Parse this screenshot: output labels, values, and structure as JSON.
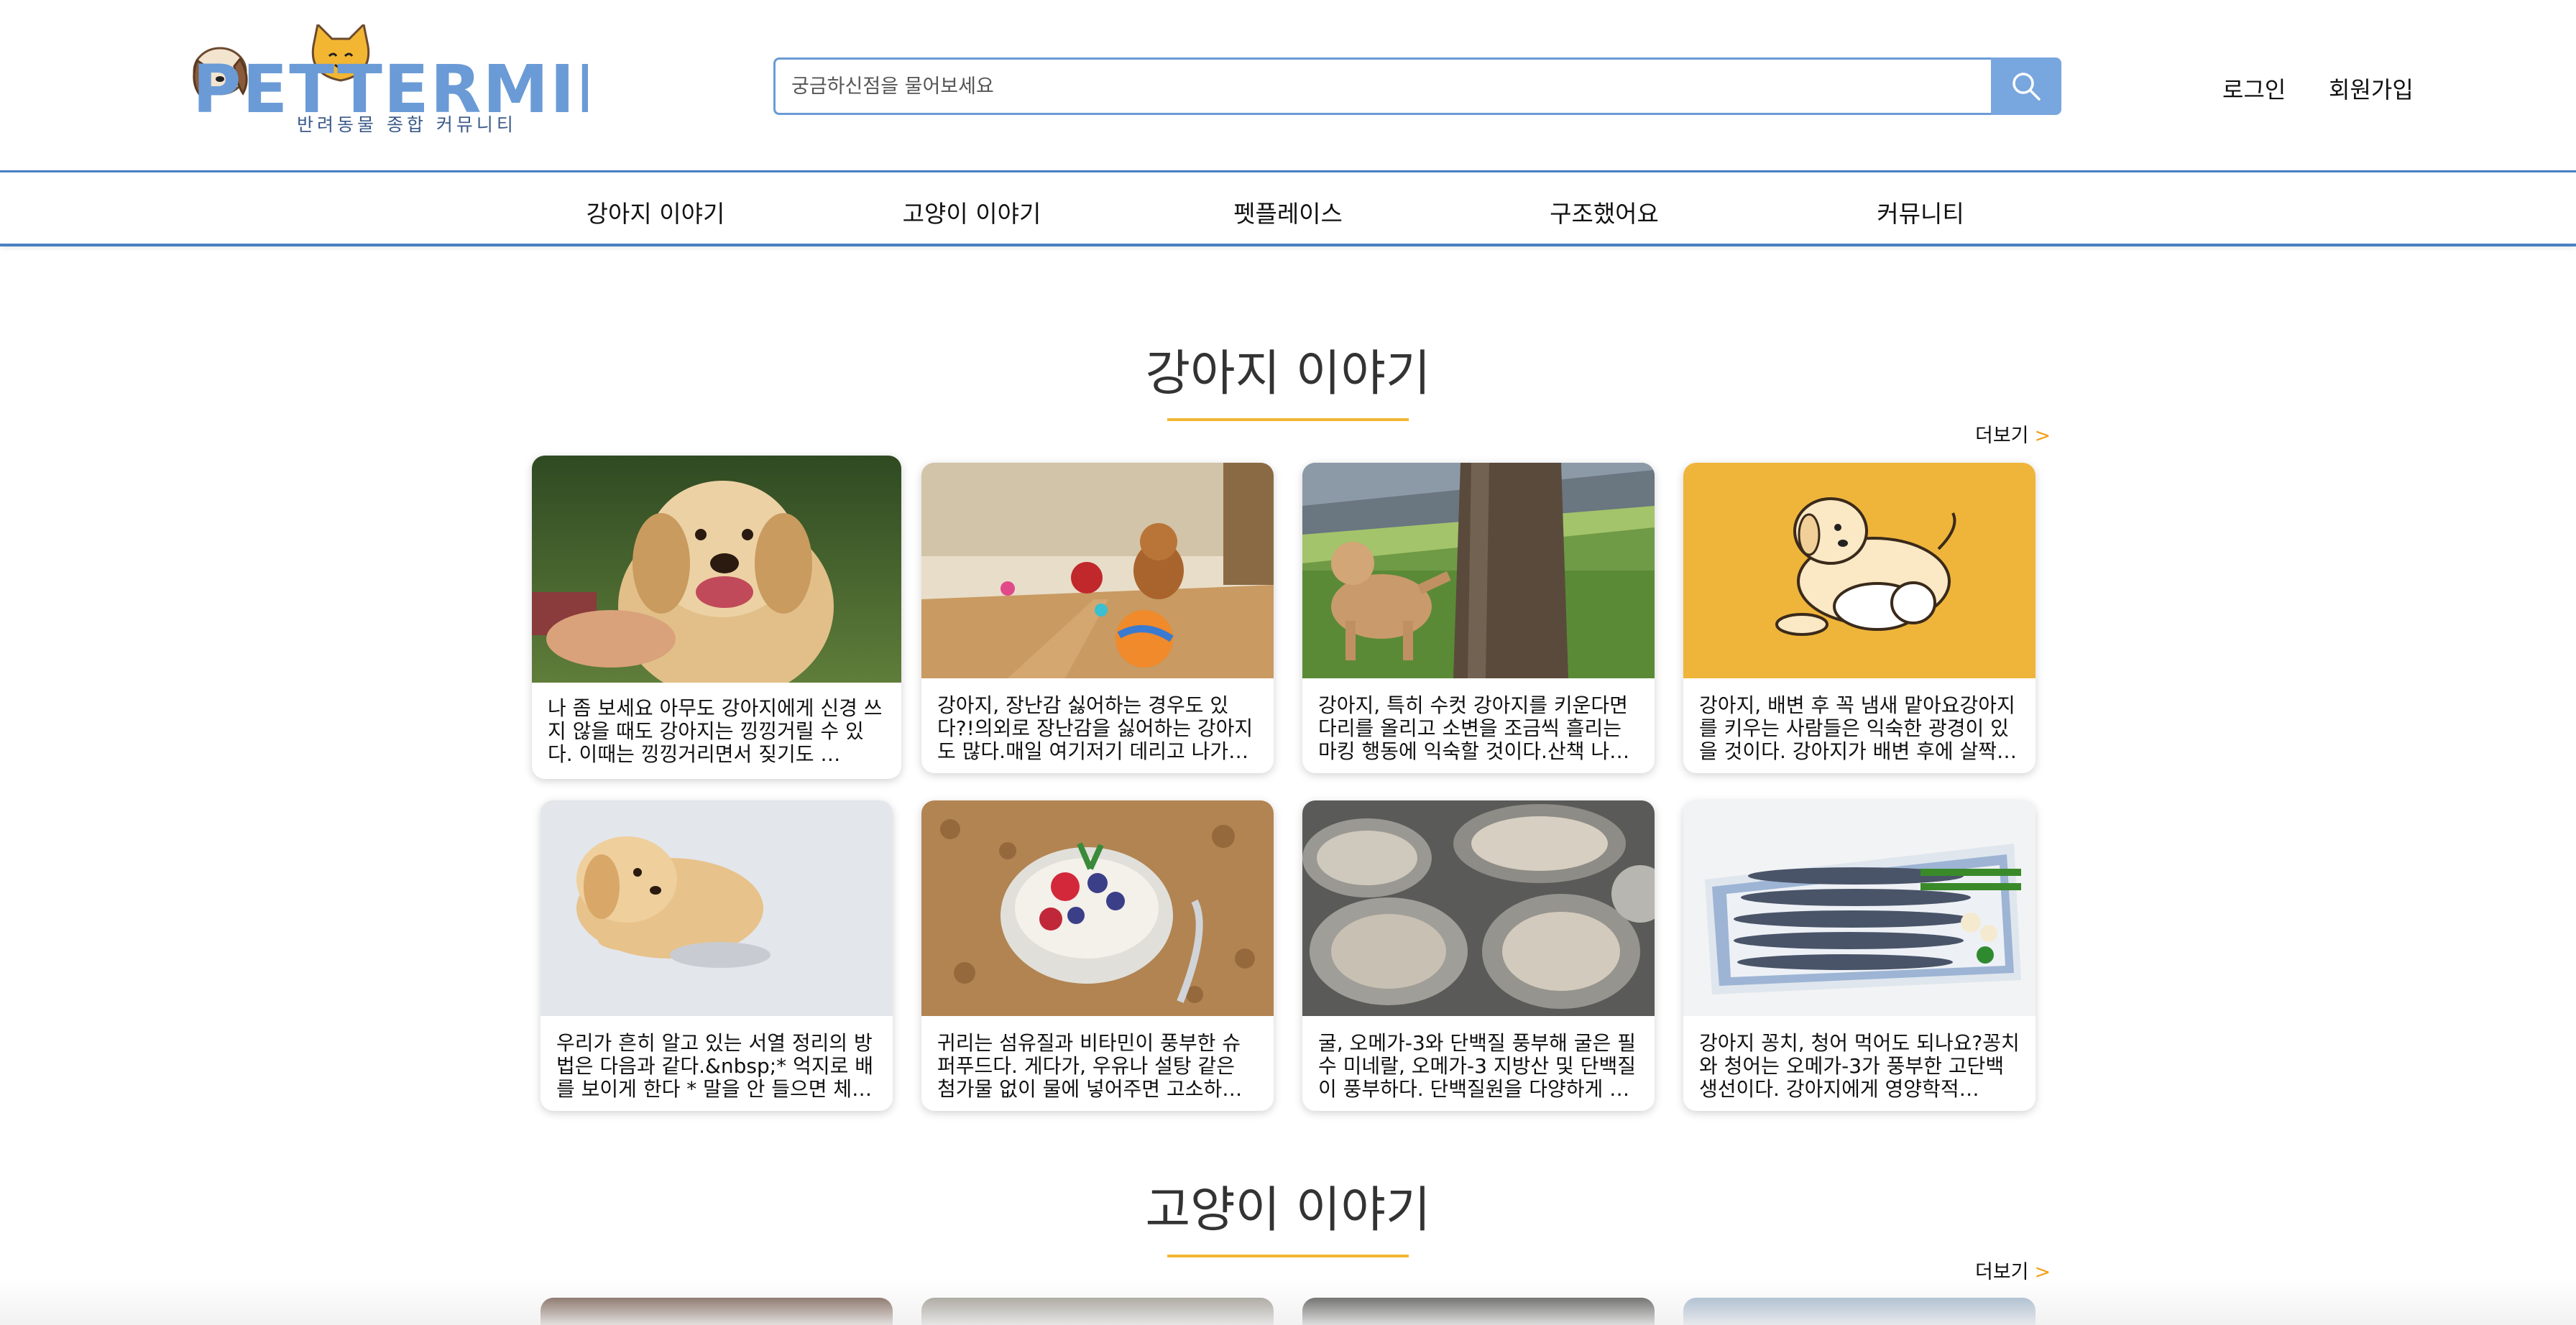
{
  "header": {
    "logo_text": "PETTERMINT",
    "logo_subtitle": "반려동물 종합 커뮤니티",
    "search_placeholder": "궁금하신점을 물어보세요",
    "login_label": "로그인",
    "signup_label": "회원가입",
    "search_icon": "search-icon"
  },
  "nav": {
    "items": [
      {
        "label": "강아지 이야기"
      },
      {
        "label": "고양이 이야기"
      },
      {
        "label": "펫플레이스"
      },
      {
        "label": "구조했어요"
      },
      {
        "label": "커뮤니티"
      }
    ]
  },
  "dog_section": {
    "title": "강아지 이야기",
    "more_label": "더보기",
    "more_arrow": ">",
    "cards": [
      {
        "text": "나 좀 보세요 아무도 강아지에게 신경 쓰지 않을 때도 강아지는 낑낑거릴 수 있다. 이때는 낑낑거리면서 짖기도 …"
      },
      {
        "text": "강아지, 장난감 싫어하는 경우도 있다?!의외로 장난감을 싫어하는 강아지도 많다.매일 여기저기 데리고 나가…"
      },
      {
        "text": "강아지, 특히 수컷 강아지를 키운다면 다리를 올리고 소변을 조금씩 흘리는 마킹 행동에 익숙할 것이다.산책 나…"
      },
      {
        "text": "강아지, 배변 후 꼭 냄새 맡아요강아지를 키우는 사람들은 익숙한 광경이 있을 것이다. 강아지가 배변 후에 살짝…"
      },
      {
        "text": "우리가 흔히 알고 있는 서열 정리의 방법은 다음과 같다.&nbsp;* 억지로 배를 보이게 한다 * 말을 안 들으면 체…"
      },
      {
        "text": "귀리는 섬유질과 비타민이 풍부한 슈퍼푸드다. 게다가, 우유나 설탕 같은 첨가물 없이 물에 넣어주면 고소하…"
      },
      {
        "text": "굴, 오메가-3와 단백질 풍부해 굴은 필수 미네랄, 오메가-3 지방산 및 단백질이 풍부하다. 단백질원을 다양하게 …"
      },
      {
        "text": "강아지 꽁치, 청어 먹어도 되나요?꽁치와 청어는 오메가-3가 풍부한 고단백 생선이다. 강아지에게 영양학적…"
      }
    ]
  },
  "cat_section": {
    "title": "고양이 이야기",
    "more_label": "더보기",
    "more_arrow": ">"
  },
  "colors": {
    "accent_blue": "#4a7fc1",
    "search_button": "#78a6de",
    "title_underline": "#f2b632",
    "more_arrow": "#f2a01a"
  }
}
